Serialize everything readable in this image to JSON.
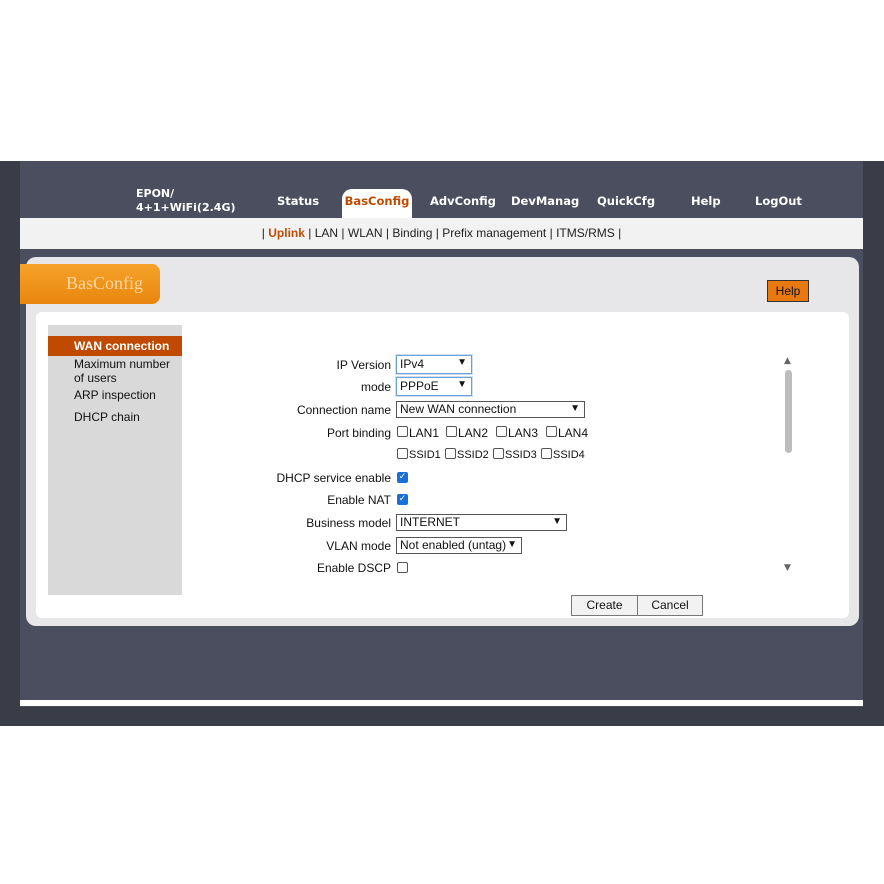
{
  "brand": {
    "line1": "EPON/",
    "line2": "4+1+WiFi(2.4G)"
  },
  "nav": {
    "status": "Status",
    "basconfig": "BasConfig",
    "advconfig": "AdvConfig",
    "devmanag": "DevManag",
    "quickcfg": "QuickCfg",
    "help": "Help",
    "logout": "LogOut"
  },
  "subnav": {
    "sep": "|",
    "uplink": "Uplink",
    "lan": "LAN",
    "wlan": "WLAN",
    "binding": "Binding",
    "prefix": "Prefix management",
    "itms": "ITMS/RMS"
  },
  "panel": {
    "title": "BasConfig",
    "help_button": "Help"
  },
  "sidebar": {
    "items": [
      {
        "label": "WAN connection"
      },
      {
        "label": "Maximum number of users"
      },
      {
        "label": "ARP inspection"
      },
      {
        "label": "DHCP chain"
      }
    ]
  },
  "form": {
    "ip_version": {
      "label": "IP Version",
      "value": "IPv4"
    },
    "mode": {
      "label": "mode",
      "value": "PPPoE"
    },
    "connection_name": {
      "label": "Connection name",
      "value": "New WAN connection"
    },
    "port_binding": {
      "label": "Port binding",
      "ports": [
        "LAN1",
        "LAN2",
        "LAN3",
        "LAN4"
      ],
      "ssids": [
        "SSID1",
        "SSID2",
        "SSID3",
        "SSID4"
      ]
    },
    "dhcp_service": {
      "label": "DHCP service enable",
      "checked": true
    },
    "enable_nat": {
      "label": "Enable NAT",
      "checked": true
    },
    "business_model": {
      "label": "Business model",
      "value": "INTERNET"
    },
    "vlan_mode": {
      "label": "VLAN mode",
      "value": "Not enabled (untag)"
    },
    "enable_dscp": {
      "label": "Enable DSCP",
      "checked": false
    }
  },
  "actions": {
    "create": "Create",
    "cancel": "Cancel"
  },
  "colors": {
    "accent": "#c04a00",
    "orange": "#e8860e",
    "header": "#4a4e5e"
  }
}
